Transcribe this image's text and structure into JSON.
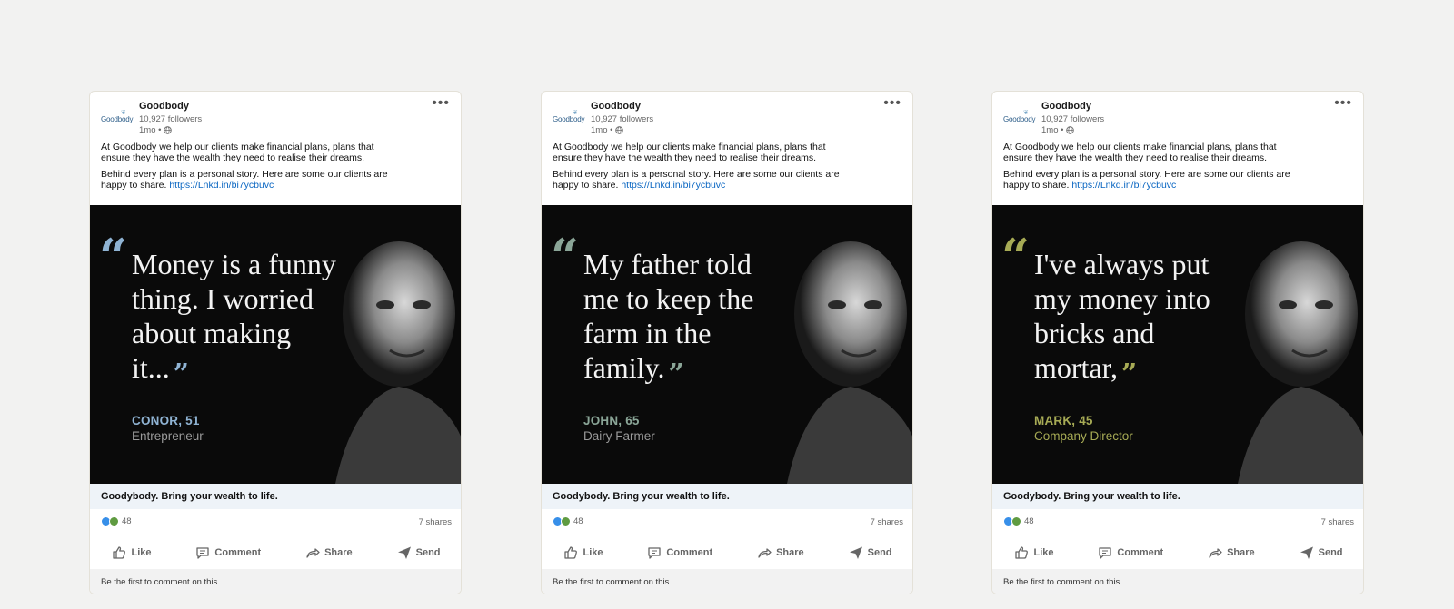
{
  "posts": [
    {
      "company": "Goodbody",
      "logo_text": "Goodbody",
      "followers": "10,927 followers",
      "time": "1mo •",
      "text_line1": "At Goodbody we help our clients make financial plans, plans that ensure they have the wealth they need to realise their dreams.",
      "text_line2": "Behind every plan is a personal story. Here are some our clients are happy to share.",
      "link": "https://Lnkd.in/bi7ycbuvc",
      "quote": "Money is a funny thing. I worried about making it...",
      "person_name": "CONOR, 51",
      "person_role": "Entrepreneur",
      "accent": "#8fb3d3",
      "caption": "Goodybody. Bring your wealth to life.",
      "reactions": "48",
      "shares": "7 shares",
      "actions": {
        "like": "Like",
        "comment": "Comment",
        "share": "Share",
        "send": "Send"
      },
      "footer": "Be the first to comment on this"
    },
    {
      "company": "Goodbody",
      "logo_text": "Goodbody",
      "followers": "10,927 followers",
      "time": "1mo •",
      "text_line1": "At Goodbody we help our clients make financial plans, plans that ensure they have the wealth they need to realise their dreams.",
      "text_line2": "Behind every plan is a personal story. Here are some our clients are happy to share.",
      "link": "https://Lnkd.in/bi7ycbuvc",
      "quote": "My father told me to keep the farm in the family.",
      "person_name": "JOHN, 65",
      "person_role": "Dairy Farmer",
      "accent": "#8aa597",
      "caption": "Goodybody. Bring your wealth to life.",
      "reactions": "48",
      "shares": "7 shares",
      "actions": {
        "like": "Like",
        "comment": "Comment",
        "share": "Share",
        "send": "Send"
      },
      "footer": "Be the first to comment on this"
    },
    {
      "company": "Goodbody",
      "logo_text": "Goodbody",
      "followers": "10,927 followers",
      "time": "1mo •",
      "text_line1": "At Goodbody we help our clients make financial plans, plans that ensure they have the wealth they need to realise their dreams.",
      "text_line2": "Behind every plan is a personal story. Here are some our clients are happy to share.",
      "link": "https://Lnkd.in/bi7ycbuvc",
      "quote": "I've always put my money into bricks and mortar,",
      "person_name": "MARK, 45",
      "person_role": "Company Director",
      "accent": "#a7ab55",
      "caption": "Goodybody. Bring your wealth to life.",
      "reactions": "48",
      "shares": "7 shares",
      "actions": {
        "like": "Like",
        "comment": "Comment",
        "share": "Share",
        "send": "Send"
      },
      "footer": "Be the first to comment on this"
    }
  ],
  "icons": {
    "more": "more-options-icon",
    "globe": "globe-icon",
    "like": "thumbs-up-icon",
    "comment": "comment-icon",
    "share": "share-arrow-icon",
    "send": "send-icon"
  }
}
